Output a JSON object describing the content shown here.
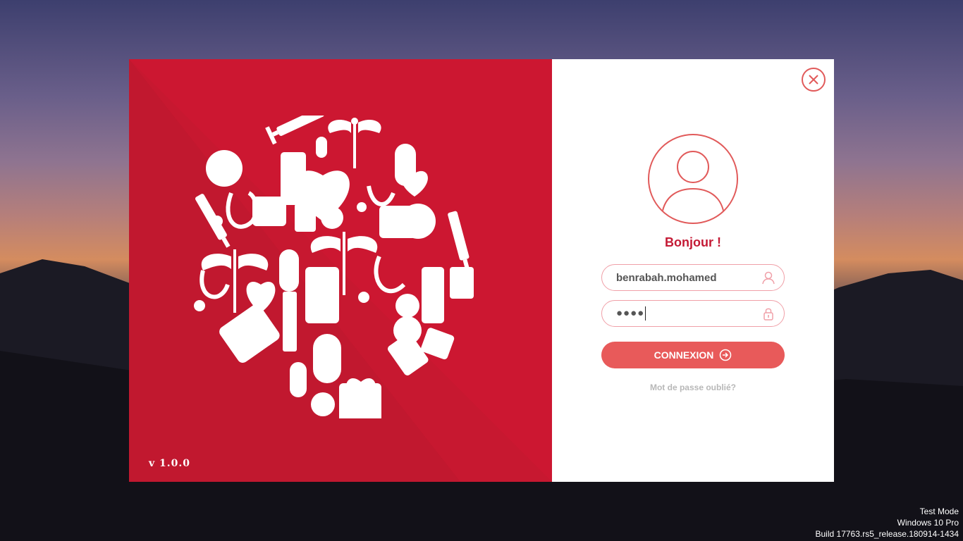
{
  "dialog": {
    "version": "v 1.0.0",
    "greeting": "Bonjour !",
    "username": {
      "value": "benrabah.mohamed",
      "icon": "user-icon"
    },
    "password": {
      "masked_value": "●●●●",
      "icon": "lock-icon"
    },
    "connect_label": "CONNEXION",
    "connect_icon": "sign-in-icon",
    "forgot_label": "Mot de passe oublié?",
    "close_icon": "close-icon",
    "avatar_icon": "user-avatar-icon",
    "illustration": "medical-icons-cluster"
  },
  "system": {
    "watermark_line1": "Test Mode",
    "watermark_line2": "Windows 10 Pro",
    "watermark_line3": "Build 17763.rs5_release.180914-1434"
  },
  "colors": {
    "brand_red": "#cc1731",
    "accent_salmon": "#e85a5a",
    "greeting_red": "#c41a35",
    "muted_text": "#b8b8b8"
  }
}
